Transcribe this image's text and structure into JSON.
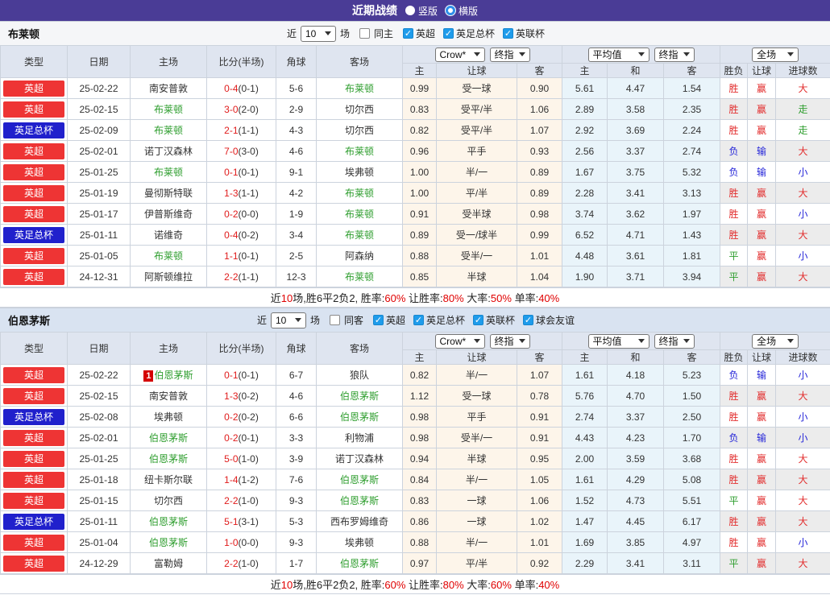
{
  "title_bar": {
    "title": "近期战绩",
    "vertical": "竖版",
    "horizontal": "横版"
  },
  "control_labels": {
    "near": "近",
    "matches": "场"
  },
  "selects": {
    "count": "10",
    "bookmaker": "Crow*",
    "final_odds": "终指",
    "average": "平均值",
    "final_odds2": "终指",
    "full_match": "全场"
  },
  "table_columns": {
    "left": [
      "类型",
      "日期",
      "主场",
      "比分(半场)",
      "角球",
      "客场"
    ],
    "odds_group": [
      "主",
      "让球",
      "客"
    ],
    "avg_group": [
      "主",
      "和",
      "客"
    ],
    "result_group": [
      "胜负",
      "让球",
      "进球数"
    ]
  },
  "colors": {
    "accent_purple": "#4a3c96",
    "league_red": "#ee3434",
    "cup_blue": "#2020cc",
    "team_green": "#2f9e2f",
    "win_red": "#e22c2c",
    "lose_blue": "#2525d8",
    "draw_green": "#2f9e2f",
    "odds_bg_cream": "#fdf5ea",
    "avg_bg_blue": "#e9f4fa",
    "header_bg": "#dfe5f0"
  },
  "sections": [
    {
      "team": "布莱顿",
      "same_label": "同主",
      "same_checked": false,
      "head_blue": false,
      "leagues": [
        "英超",
        "英足总杯",
        "英联杯"
      ],
      "rows": [
        {
          "lg": "英超",
          "lgc": "red",
          "date": "25-02-22",
          "home": "南安普敦",
          "hteam": false,
          "hbadge": "",
          "ft": "0-4",
          "ht": "(0-1)",
          "cn": "5-6",
          "away": "布莱顿",
          "ateam": true,
          "oh": "0.99",
          "hc": "受一球",
          "oa": "0.90",
          "ah": "5.61",
          "ad": "4.47",
          "aa": "1.54",
          "r": "胜",
          "rc": "r",
          "hr": "赢",
          "hrc": "r",
          "g": "大",
          "gc": "r"
        },
        {
          "lg": "英超",
          "lgc": "red",
          "date": "25-02-15",
          "home": "布莱顿",
          "hteam": true,
          "hbadge": "",
          "ft": "3-0",
          "ht": "(2-0)",
          "cn": "2-9",
          "away": "切尔西",
          "ateam": false,
          "oh": "0.83",
          "hc": "受平/半",
          "oa": "1.06",
          "ah": "2.89",
          "ad": "3.58",
          "aa": "2.35",
          "r": "胜",
          "rc": "r",
          "hr": "赢",
          "hrc": "r",
          "g": "走",
          "gc": "g"
        },
        {
          "lg": "英足总杯",
          "lgc": "blue",
          "date": "25-02-09",
          "home": "布莱顿",
          "hteam": true,
          "hbadge": "",
          "ft": "2-1",
          "ht": "(1-1)",
          "cn": "4-3",
          "away": "切尔西",
          "ateam": false,
          "oh": "0.82",
          "hc": "受平/半",
          "oa": "1.07",
          "ah": "2.92",
          "ad": "3.69",
          "aa": "2.24",
          "r": "胜",
          "rc": "r",
          "hr": "赢",
          "hrc": "r",
          "g": "走",
          "gc": "g"
        },
        {
          "lg": "英超",
          "lgc": "red",
          "date": "25-02-01",
          "home": "诺丁汉森林",
          "hteam": false,
          "hbadge": "",
          "ft": "7-0",
          "ht": "(3-0)",
          "cn": "4-6",
          "away": "布莱顿",
          "ateam": true,
          "oh": "0.96",
          "hc": "平手",
          "oa": "0.93",
          "ah": "2.56",
          "ad": "3.37",
          "aa": "2.74",
          "r": "负",
          "rc": "b",
          "hr": "输",
          "hrc": "b",
          "g": "大",
          "gc": "r"
        },
        {
          "lg": "英超",
          "lgc": "red",
          "date": "25-01-25",
          "home": "布莱顿",
          "hteam": true,
          "hbadge": "",
          "ft": "0-1",
          "ht": "(0-1)",
          "cn": "9-1",
          "away": "埃弗顿",
          "ateam": false,
          "oh": "1.00",
          "hc": "半/一",
          "oa": "0.89",
          "ah": "1.67",
          "ad": "3.75",
          "aa": "5.32",
          "r": "负",
          "rc": "b",
          "hr": "输",
          "hrc": "b",
          "g": "小",
          "gc": "b"
        },
        {
          "lg": "英超",
          "lgc": "red",
          "date": "25-01-19",
          "home": "曼彻斯特联",
          "hteam": false,
          "hbadge": "",
          "ft": "1-3",
          "ht": "(1-1)",
          "cn": "4-2",
          "away": "布莱顿",
          "ateam": true,
          "oh": "1.00",
          "hc": "平/半",
          "oa": "0.89",
          "ah": "2.28",
          "ad": "3.41",
          "aa": "3.13",
          "r": "胜",
          "rc": "r",
          "hr": "赢",
          "hrc": "r",
          "g": "大",
          "gc": "r"
        },
        {
          "lg": "英超",
          "lgc": "red",
          "date": "25-01-17",
          "home": "伊普斯维奇",
          "hteam": false,
          "hbadge": "",
          "ft": "0-2",
          "ht": "(0-0)",
          "cn": "1-9",
          "away": "布莱顿",
          "ateam": true,
          "oh": "0.91",
          "hc": "受半球",
          "oa": "0.98",
          "ah": "3.74",
          "ad": "3.62",
          "aa": "1.97",
          "r": "胜",
          "rc": "r",
          "hr": "赢",
          "hrc": "r",
          "g": "小",
          "gc": "b"
        },
        {
          "lg": "英足总杯",
          "lgc": "blue",
          "date": "25-01-11",
          "home": "诺维奇",
          "hteam": false,
          "hbadge": "",
          "ft": "0-4",
          "ht": "(0-2)",
          "cn": "3-4",
          "away": "布莱顿",
          "ateam": true,
          "oh": "0.89",
          "hc": "受一/球半",
          "oa": "0.99",
          "ah": "6.52",
          "ad": "4.71",
          "aa": "1.43",
          "r": "胜",
          "rc": "r",
          "hr": "赢",
          "hrc": "r",
          "g": "大",
          "gc": "r"
        },
        {
          "lg": "英超",
          "lgc": "red",
          "date": "25-01-05",
          "home": "布莱顿",
          "hteam": true,
          "hbadge": "",
          "ft": "1-1",
          "ht": "(0-1)",
          "cn": "2-5",
          "away": "阿森纳",
          "ateam": false,
          "oh": "0.88",
          "hc": "受半/一",
          "oa": "1.01",
          "ah": "4.48",
          "ad": "3.61",
          "aa": "1.81",
          "r": "平",
          "rc": "g",
          "hr": "赢",
          "hrc": "r",
          "g": "小",
          "gc": "b"
        },
        {
          "lg": "英超",
          "lgc": "red",
          "date": "24-12-31",
          "home": "阿斯顿维拉",
          "hteam": false,
          "hbadge": "",
          "ft": "2-2",
          "ht": "(1-1)",
          "cn": "12-3",
          "away": "布莱顿",
          "ateam": true,
          "oh": "0.85",
          "hc": "半球",
          "oa": "1.04",
          "ah": "1.90",
          "ad": "3.71",
          "aa": "3.94",
          "r": "平",
          "rc": "g",
          "hr": "赢",
          "hrc": "r",
          "g": "大",
          "gc": "r"
        }
      ],
      "summary": [
        {
          "t": "近",
          "red": false
        },
        {
          "t": "10",
          "red": true
        },
        {
          "t": "场,胜6平2负2, 胜率:",
          "red": false
        },
        {
          "t": "60%",
          "red": true
        },
        {
          "t": " 让胜率:",
          "red": false
        },
        {
          "t": "80%",
          "red": true
        },
        {
          "t": " 大率:",
          "red": false
        },
        {
          "t": "50%",
          "red": true
        },
        {
          "t": " 单率:",
          "red": false
        },
        {
          "t": "40%",
          "red": true
        }
      ]
    },
    {
      "team": "伯恩茅斯",
      "same_label": "同客",
      "same_checked": false,
      "head_blue": true,
      "leagues": [
        "英超",
        "英足总杯",
        "英联杯",
        "球会友谊"
      ],
      "rows": [
        {
          "lg": "英超",
          "lgc": "red",
          "date": "25-02-22",
          "home": "伯恩茅斯",
          "hteam": true,
          "hbadge": "1",
          "ft": "0-1",
          "ht": "(0-1)",
          "cn": "6-7",
          "away": "狼队",
          "ateam": false,
          "oh": "0.82",
          "hc": "半/一",
          "oa": "1.07",
          "ah": "1.61",
          "ad": "4.18",
          "aa": "5.23",
          "r": "负",
          "rc": "b",
          "hr": "输",
          "hrc": "b",
          "g": "小",
          "gc": "b"
        },
        {
          "lg": "英超",
          "lgc": "red",
          "date": "25-02-15",
          "home": "南安普敦",
          "hteam": false,
          "hbadge": "",
          "ft": "1-3",
          "ht": "(0-2)",
          "cn": "4-6",
          "away": "伯恩茅斯",
          "ateam": true,
          "oh": "1.12",
          "hc": "受一球",
          "oa": "0.78",
          "ah": "5.76",
          "ad": "4.70",
          "aa": "1.50",
          "r": "胜",
          "rc": "r",
          "hr": "赢",
          "hrc": "r",
          "g": "大",
          "gc": "r"
        },
        {
          "lg": "英足总杯",
          "lgc": "blue",
          "date": "25-02-08",
          "home": "埃弗顿",
          "hteam": false,
          "hbadge": "",
          "ft": "0-2",
          "ht": "(0-2)",
          "cn": "6-6",
          "away": "伯恩茅斯",
          "ateam": true,
          "oh": "0.98",
          "hc": "平手",
          "oa": "0.91",
          "ah": "2.74",
          "ad": "3.37",
          "aa": "2.50",
          "r": "胜",
          "rc": "r",
          "hr": "赢",
          "hrc": "r",
          "g": "小",
          "gc": "b"
        },
        {
          "lg": "英超",
          "lgc": "red",
          "date": "25-02-01",
          "home": "伯恩茅斯",
          "hteam": true,
          "hbadge": "",
          "ft": "0-2",
          "ht": "(0-1)",
          "cn": "3-3",
          "away": "利物浦",
          "ateam": false,
          "oh": "0.98",
          "hc": "受半/一",
          "oa": "0.91",
          "ah": "4.43",
          "ad": "4.23",
          "aa": "1.70",
          "r": "负",
          "rc": "b",
          "hr": "输",
          "hrc": "b",
          "g": "小",
          "gc": "b"
        },
        {
          "lg": "英超",
          "lgc": "red",
          "date": "25-01-25",
          "home": "伯恩茅斯",
          "hteam": true,
          "hbadge": "",
          "ft": "5-0",
          "ht": "(1-0)",
          "cn": "3-9",
          "away": "诺丁汉森林",
          "ateam": false,
          "oh": "0.94",
          "hc": "半球",
          "oa": "0.95",
          "ah": "2.00",
          "ad": "3.59",
          "aa": "3.68",
          "r": "胜",
          "rc": "r",
          "hr": "赢",
          "hrc": "r",
          "g": "大",
          "gc": "r"
        },
        {
          "lg": "英超",
          "lgc": "red",
          "date": "25-01-18",
          "home": "纽卡斯尔联",
          "hteam": false,
          "hbadge": "",
          "ft": "1-4",
          "ht": "(1-2)",
          "cn": "7-6",
          "away": "伯恩茅斯",
          "ateam": true,
          "oh": "0.84",
          "hc": "半/一",
          "oa": "1.05",
          "ah": "1.61",
          "ad": "4.29",
          "aa": "5.08",
          "r": "胜",
          "rc": "r",
          "hr": "赢",
          "hrc": "r",
          "g": "大",
          "gc": "r"
        },
        {
          "lg": "英超",
          "lgc": "red",
          "date": "25-01-15",
          "home": "切尔西",
          "hteam": false,
          "hbadge": "",
          "ft": "2-2",
          "ht": "(1-0)",
          "cn": "9-3",
          "away": "伯恩茅斯",
          "ateam": true,
          "oh": "0.83",
          "hc": "一球",
          "oa": "1.06",
          "ah": "1.52",
          "ad": "4.73",
          "aa": "5.51",
          "r": "平",
          "rc": "g",
          "hr": "赢",
          "hrc": "r",
          "g": "大",
          "gc": "r"
        },
        {
          "lg": "英足总杯",
          "lgc": "blue",
          "date": "25-01-11",
          "home": "伯恩茅斯",
          "hteam": true,
          "hbadge": "",
          "ft": "5-1",
          "ht": "(3-1)",
          "cn": "5-3",
          "away": "西布罗姆维奇",
          "ateam": false,
          "oh": "0.86",
          "hc": "一球",
          "oa": "1.02",
          "ah": "1.47",
          "ad": "4.45",
          "aa": "6.17",
          "r": "胜",
          "rc": "r",
          "hr": "赢",
          "hrc": "r",
          "g": "大",
          "gc": "r"
        },
        {
          "lg": "英超",
          "lgc": "red",
          "date": "25-01-04",
          "home": "伯恩茅斯",
          "hteam": true,
          "hbadge": "",
          "ft": "1-0",
          "ht": "(0-0)",
          "cn": "9-3",
          "away": "埃弗顿",
          "ateam": false,
          "oh": "0.88",
          "hc": "半/一",
          "oa": "1.01",
          "ah": "1.69",
          "ad": "3.85",
          "aa": "4.97",
          "r": "胜",
          "rc": "r",
          "hr": "赢",
          "hrc": "r",
          "g": "小",
          "gc": "b"
        },
        {
          "lg": "英超",
          "lgc": "red",
          "date": "24-12-29",
          "home": "富勒姆",
          "hteam": false,
          "hbadge": "",
          "ft": "2-2",
          "ht": "(1-0)",
          "cn": "1-7",
          "away": "伯恩茅斯",
          "ateam": true,
          "oh": "0.97",
          "hc": "平/半",
          "oa": "0.92",
          "ah": "2.29",
          "ad": "3.41",
          "aa": "3.11",
          "r": "平",
          "rc": "g",
          "hr": "赢",
          "hrc": "r",
          "g": "大",
          "gc": "r"
        }
      ],
      "summary": [
        {
          "t": "近",
          "red": false
        },
        {
          "t": "10",
          "red": true
        },
        {
          "t": "场,胜6平2负2, 胜率:",
          "red": false
        },
        {
          "t": "60%",
          "red": true
        },
        {
          "t": " 让胜率:",
          "red": false
        },
        {
          "t": "80%",
          "red": true
        },
        {
          "t": " 大率:",
          "red": false
        },
        {
          "t": "60%",
          "red": true
        },
        {
          "t": " 单率:",
          "red": false
        },
        {
          "t": "40%",
          "red": true
        }
      ]
    }
  ]
}
